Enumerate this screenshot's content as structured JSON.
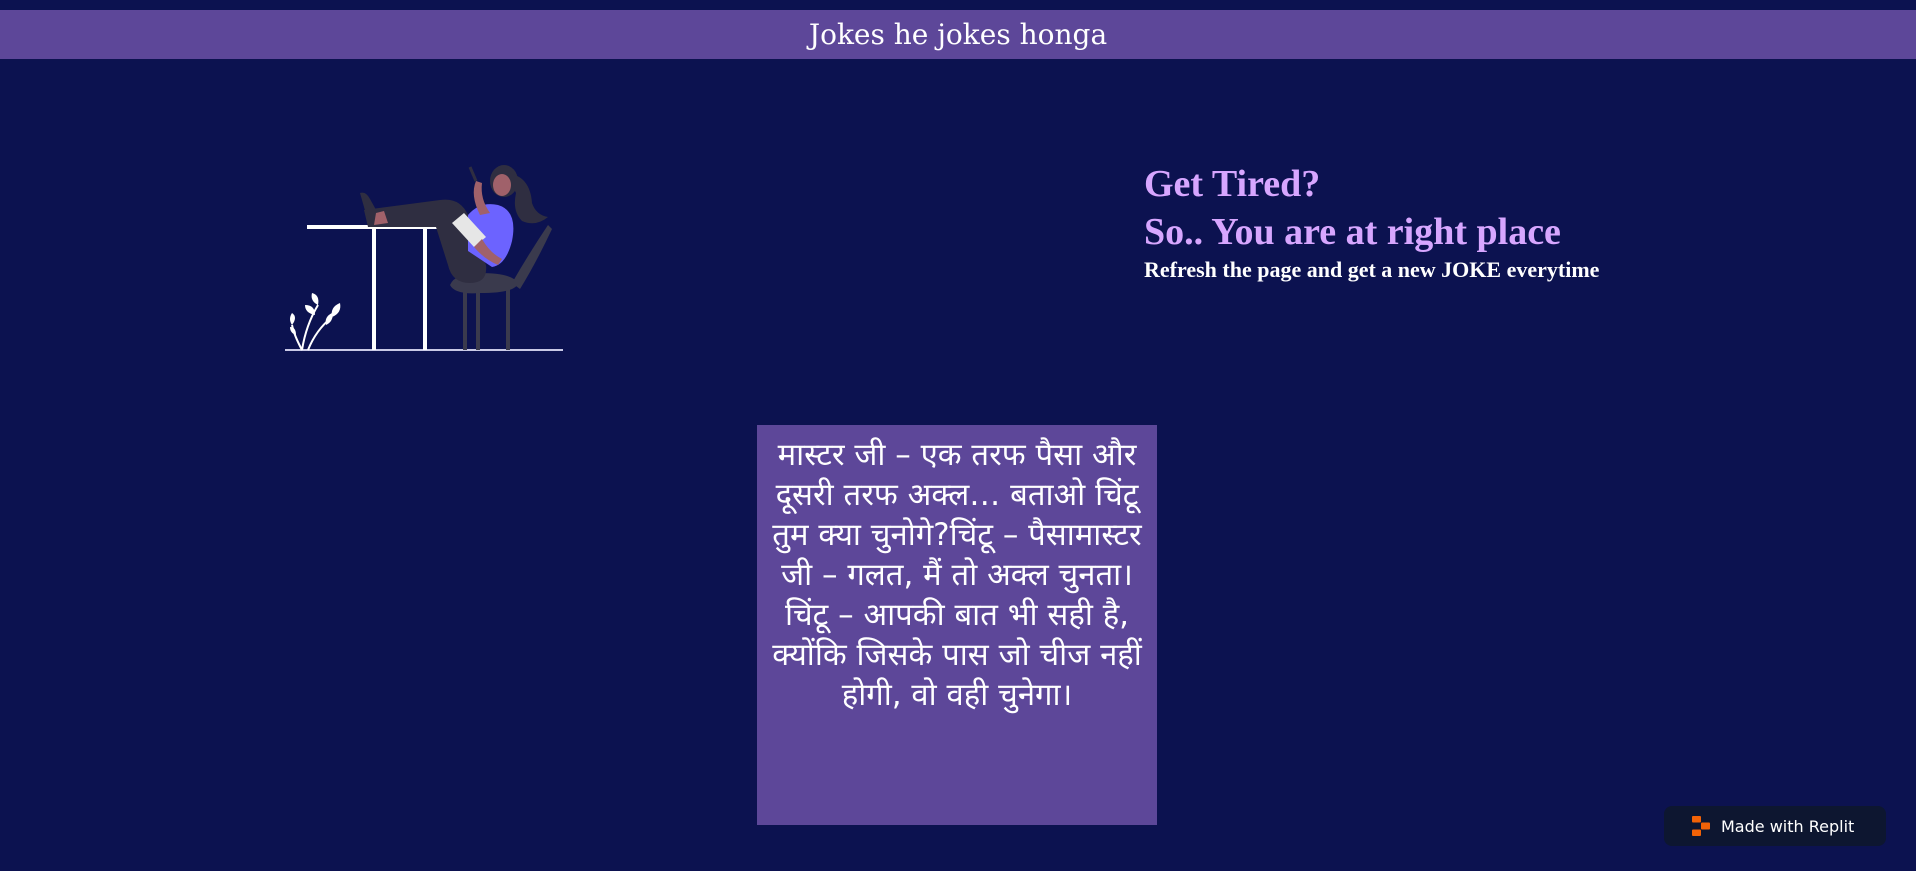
{
  "header": {
    "title": "Jokes he jokes honga"
  },
  "hero": {
    "line1": "Get Tired?",
    "line2": "So.. You are at right place",
    "subtitle": "Refresh the page and get a new JOKE everytime"
  },
  "joke": {
    "text": "मास्टर जी – एक तरफ पैसा और दूसरी तरफ अक्ल… बताओ चिंटू तुम क्या चुनोगे?चिंटू – पैसामास्टर जी – गलत, मैं तो अक्ल चुनता।चिंटू – आपकी बात भी सही है, क्योंकि जिसके पास जो चीज नहीं होगी, वो वही चुनेगा।"
  },
  "badge": {
    "label": "Made with Replit",
    "icon": "replit-icon"
  },
  "colors": {
    "background": "#0c1250",
    "header_bg": "#5d4799",
    "accent_text": "#d7a6ff",
    "joke_bg": "#5d4799",
    "badge_bg": "#0d1630",
    "replit_orange": "#f26207"
  },
  "illustration": {
    "icon": "woman-relaxing-illustration"
  }
}
